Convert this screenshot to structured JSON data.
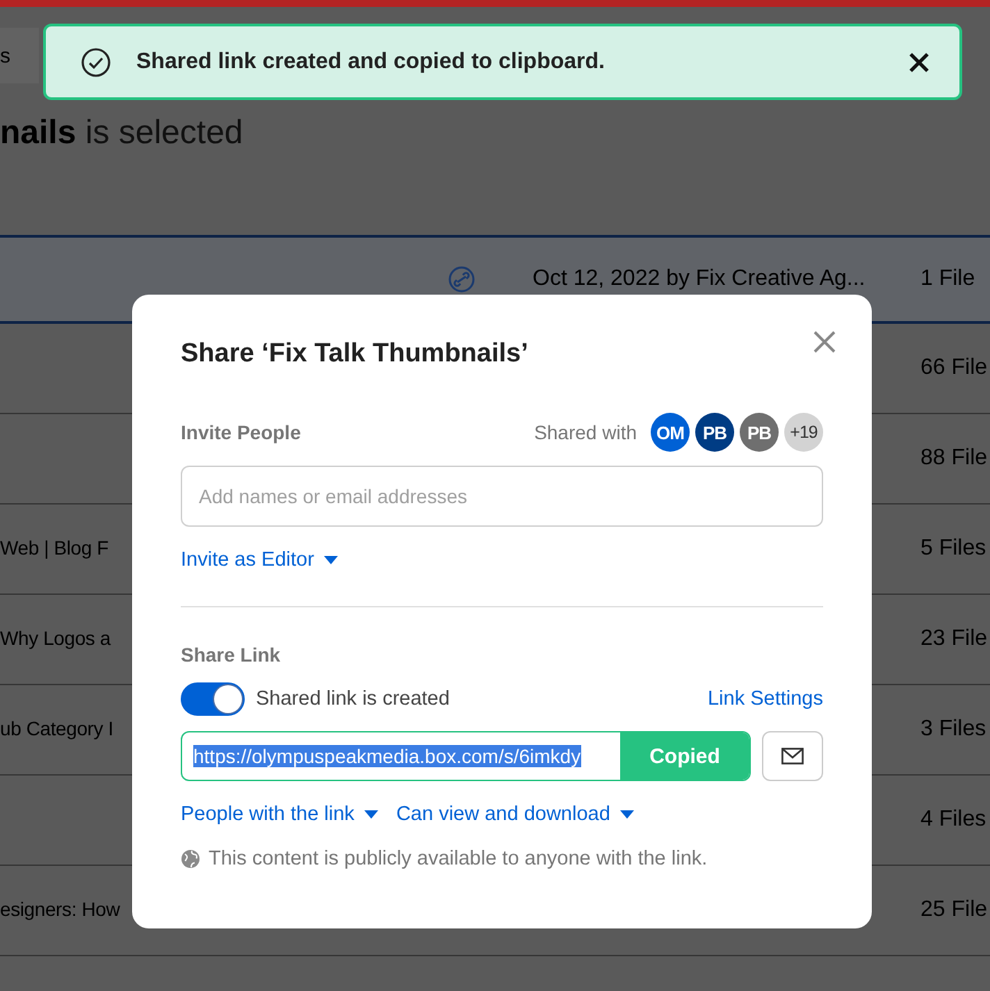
{
  "background": {
    "tab_fragment": "s",
    "heading": "**nails** is selected",
    "header_row": {
      "date": "Oct 12, 2022 by Fix Creative Ag...",
      "count": "1 File"
    },
    "rows": [
      {
        "count": "66 File"
      },
      {
        "count": "88 File"
      },
      {
        "name": "Web | Blog F",
        "count": "5 Files"
      },
      {
        "name": "Why Logos a",
        "count": "23 File"
      },
      {
        "name": "ub Category I",
        "count": "3 Files"
      },
      {
        "count": "4 Files"
      },
      {
        "name": "esigners: How",
        "count": "25 File"
      }
    ]
  },
  "toast": {
    "message": "Shared link created and copied to clipboard."
  },
  "dialog": {
    "title": "Share ‘Fix Talk Thumbnails’",
    "invite_label": "Invite People",
    "shared_with_label": "Shared with",
    "collaborators": [
      {
        "kind": "avatar",
        "initials": "OM",
        "color": "#0061d5"
      },
      {
        "kind": "avatar",
        "initials": "PB",
        "color": "#003c84"
      },
      {
        "kind": "avatar",
        "initials": "PB",
        "color": "#6f6f6f"
      },
      {
        "kind": "count",
        "initials": "+19",
        "color": "#d3d3d3"
      }
    ],
    "invite_field": {
      "placeholder": "Add names or email addresses"
    },
    "role": "Invite as Editor",
    "share_link_label": "Share Link",
    "toggle": {
      "label": "Shared link is created",
      "on": true
    },
    "link_settings": "Link Settings",
    "url": {
      "value": "https://olympuspeakmedia.box.com/s/6imkdy",
      "selected": true
    },
    "copy_button": "Copied",
    "access": "People with the link",
    "permission": "Can view and download",
    "notice": "This content is publicly available to anyone with the link."
  }
}
